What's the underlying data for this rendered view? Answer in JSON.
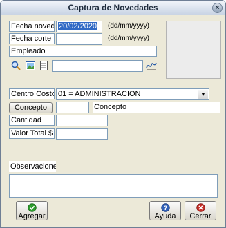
{
  "window": {
    "title": "Captura de Novedades",
    "close_symbol": "×"
  },
  "fields": {
    "fecha_novedad": {
      "label": "Fecha novedad",
      "value": "20/02/2020",
      "hint": "(dd/mm/yyyy)"
    },
    "fecha_corte": {
      "label": "Fecha corte",
      "value": "",
      "hint": "(dd/mm/yyyy)"
    },
    "empleado": {
      "label": "Empleado",
      "value": ""
    },
    "centro_costo": {
      "label": "Centro Costo",
      "value": "01 = ADMINISTRACION"
    },
    "concepto": {
      "button_label": "Concepto",
      "code": "",
      "description": "Concepto"
    },
    "cantidad": {
      "label": "Cantidad",
      "value": ""
    },
    "valor_total": {
      "label": "Valor Total $",
      "value": ""
    },
    "observaciones": {
      "label": "Observaciones",
      "value": ""
    }
  },
  "icons": {
    "search": "search-icon",
    "photo": "photo-icon",
    "document": "document-icon",
    "sign": "signature-icon"
  },
  "buttons": {
    "agregar": {
      "label": "Agregar",
      "icon": "check-icon",
      "color": "#2e9e2e"
    },
    "ayuda": {
      "label": "Ayuda",
      "icon": "help-icon",
      "color": "#2f5fb8"
    },
    "cerrar": {
      "label": "Cerrar",
      "icon": "close-icon",
      "color": "#c8302a"
    }
  }
}
